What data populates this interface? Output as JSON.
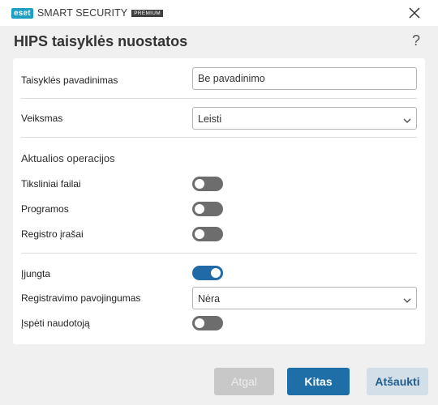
{
  "brand": {
    "logo_text": "eset",
    "product": "SMART SECURITY",
    "tier": "PREMIUM",
    "accent_color": "#1d9fc4"
  },
  "window": {
    "close_icon": "close-icon"
  },
  "header": {
    "title": "HIPS taisyklės nuostatos",
    "help_label": "?"
  },
  "form": {
    "rule_name_label": "Taisyklės pavadinimas",
    "rule_name_value": "Be pavadinimo",
    "action_label": "Veiksmas",
    "action_value": "Leisti",
    "operations_title": "Aktualios operacijos",
    "files_label": "Tiksliniai failai",
    "files_enabled": false,
    "apps_label": "Programos",
    "apps_enabled": false,
    "registry_label": "Registro įrašai",
    "registry_enabled": false,
    "enabled_label": "Įjungta",
    "enabled_value": true,
    "log_severity_label": "Registravimo pavojingumas",
    "log_severity_value": "Nėra",
    "notify_label": "Įspėti naudotoją",
    "notify_enabled": false,
    "toggle_on_color": "#1f6aa7",
    "toggle_off_color": "#6d6d6d"
  },
  "footer": {
    "back_label": "Atgal",
    "next_label": "Kitas",
    "cancel_label": "Atšaukti"
  }
}
